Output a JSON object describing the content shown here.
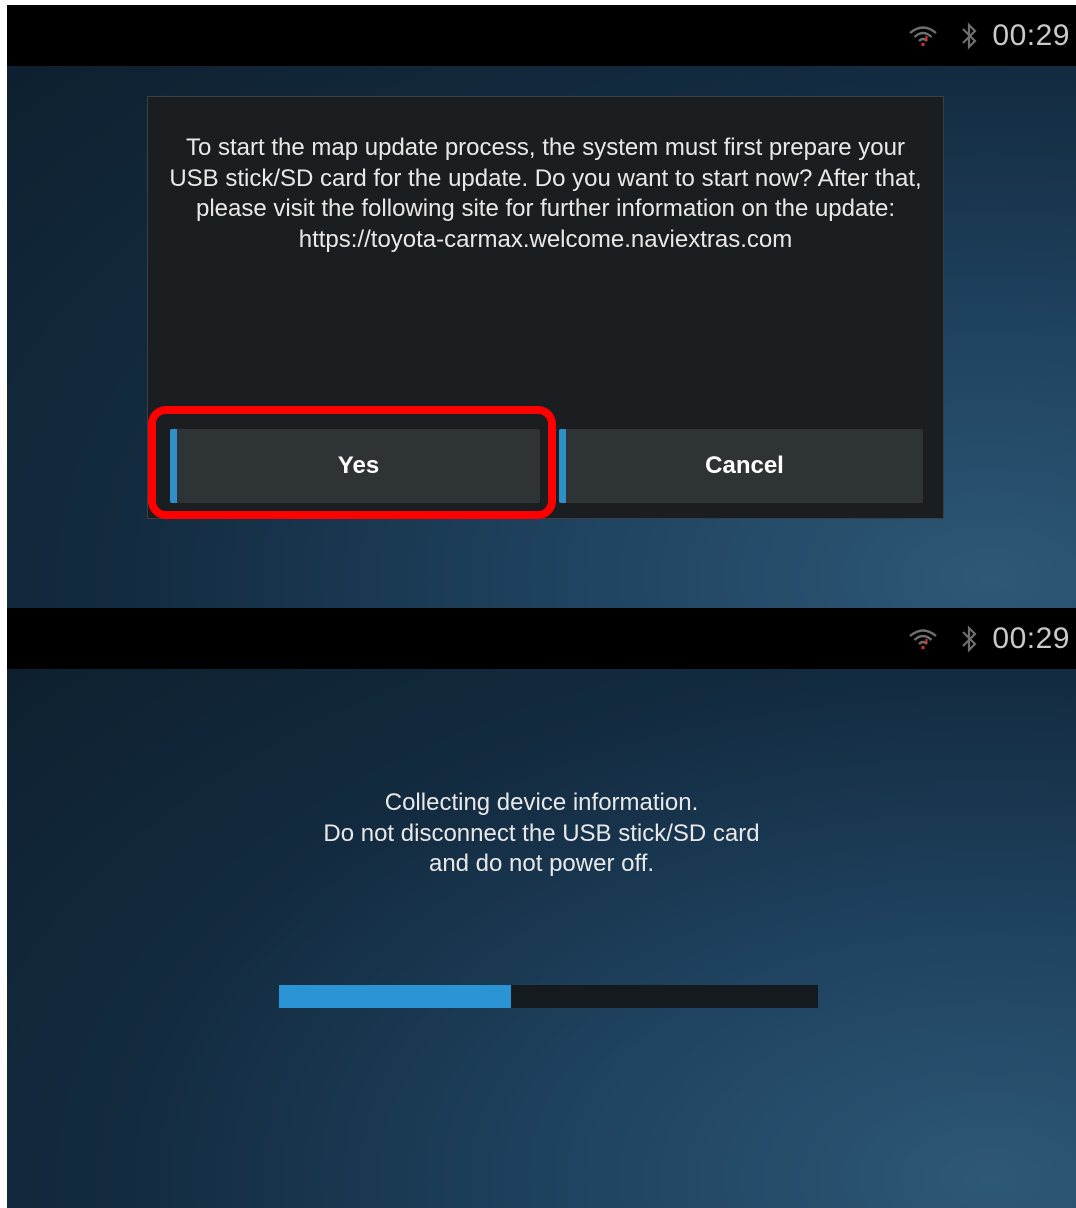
{
  "screens": [
    {
      "status_bar": {
        "time": "00:29",
        "icons": [
          "wifi-icon",
          "bluetooth-icon"
        ]
      },
      "dialog": {
        "message": "To start the map update process, the system must first prepare your USB stick/SD card for the update. Do you want to start now? After that, please visit the following site for further information on the update: https://toyota-carmax.welcome.naviextras.com",
        "buttons": {
          "yes": "Yes",
          "cancel": "Cancel"
        },
        "highlighted_button": "yes"
      }
    },
    {
      "status_bar": {
        "time": "00:29",
        "icons": [
          "wifi-icon",
          "bluetooth-icon"
        ]
      },
      "progress": {
        "message_lines": [
          "Collecting device information.",
          "Do not disconnect the USB stick/SD card",
          "and do not power off."
        ],
        "value_fraction": 0.43
      }
    }
  ],
  "colors": {
    "accent": "#2b94d4",
    "highlight": "#ff0000",
    "dialog_bg": "#1b1e20",
    "button_bg": "#2e3336"
  }
}
